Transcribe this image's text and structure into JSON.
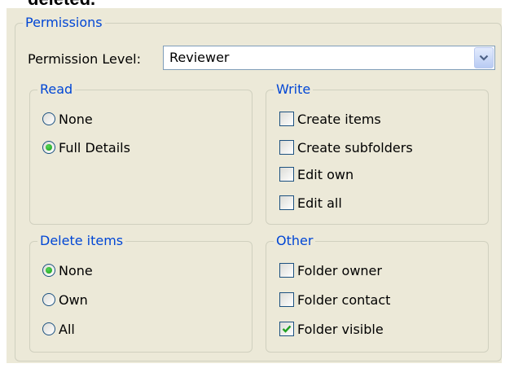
{
  "cut_heading": "deleted.",
  "permissions": {
    "title": "Permissions",
    "level_label": "Permission Level:",
    "level_value": "Reviewer"
  },
  "read": {
    "title": "Read",
    "options": [
      {
        "label": "None",
        "checked": false
      },
      {
        "label": "Full Details",
        "checked": true
      }
    ]
  },
  "write": {
    "title": "Write",
    "options": [
      {
        "label": "Create items",
        "checked": false
      },
      {
        "label": "Create subfolders",
        "checked": false
      },
      {
        "label": "Edit own",
        "checked": false
      },
      {
        "label": "Edit all",
        "checked": false
      }
    ]
  },
  "delete_items": {
    "title": "Delete items",
    "options": [
      {
        "label": "None",
        "checked": true
      },
      {
        "label": "Own",
        "checked": false
      },
      {
        "label": "All",
        "checked": false
      }
    ]
  },
  "other": {
    "title": "Other",
    "options": [
      {
        "label": "Folder owner",
        "checked": false
      },
      {
        "label": "Folder contact",
        "checked": false
      },
      {
        "label": "Folder visible",
        "checked": true
      }
    ]
  },
  "colors": {
    "group_title": "#0046d5",
    "panel": "#ece9d8",
    "check_mark": "#21a121"
  },
  "icons": {
    "dropdown": "chevron-down-icon",
    "check": "checkmark-icon"
  }
}
